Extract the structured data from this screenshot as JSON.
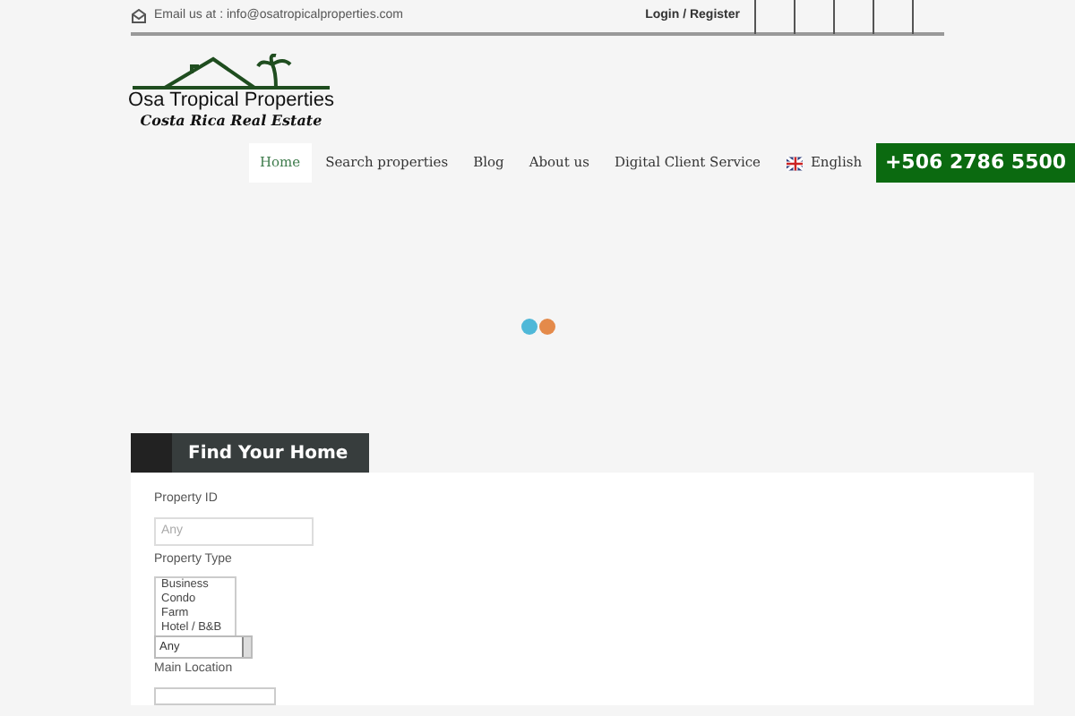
{
  "top_bar": {
    "email_text": "Email us at : info@osatropicalproperties.com",
    "login": "Login / Register"
  },
  "logo": {
    "name": "Osa Tropical Properties",
    "tagline": "Costa Rica Real Estate"
  },
  "nav": {
    "items": [
      {
        "label": "Home",
        "selected": true
      },
      {
        "label": "Search properties",
        "selected": false
      },
      {
        "label": "Blog",
        "selected": false
      },
      {
        "label": "About us",
        "selected": false
      },
      {
        "label": "Digital Client Service",
        "selected": false
      }
    ],
    "language": "English",
    "phone": "+506 2786 5500"
  },
  "search": {
    "title": "Find Your Home",
    "property_id": {
      "label": "Property ID",
      "placeholder": "Any"
    },
    "property_type": {
      "label": "Property Type",
      "options": [
        "Business",
        "Condo",
        "Farm",
        "Hotel / B&B"
      ],
      "select_value": "Any"
    },
    "main_location": {
      "label": "Main Location"
    }
  }
}
